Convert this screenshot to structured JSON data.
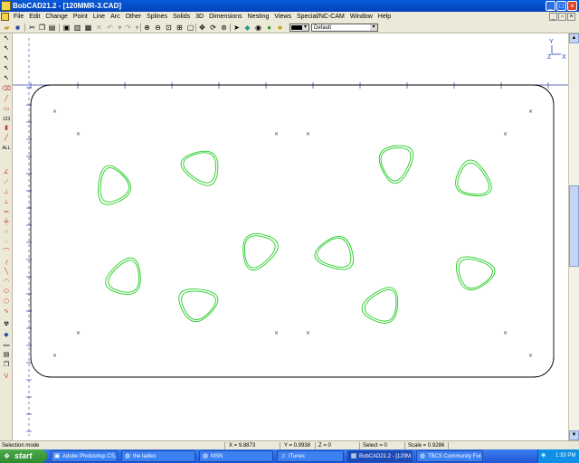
{
  "window": {
    "title": "BobCAD21.2 - [120MMR-3.CAD]"
  },
  "menu": [
    "File",
    "Edit",
    "Change",
    "Point",
    "Line",
    "Arc",
    "Other",
    "Splines",
    "Solids",
    "3D",
    "Dimensions",
    "Nesting",
    "Views",
    "Special/NC-CAM",
    "Window",
    "Help"
  ],
  "toolbar": {
    "color_value": "black",
    "layer_value": "Default"
  },
  "icons": {
    "minimize": "minimize-icon",
    "maximize": "maximize-icon",
    "close": "close-icon"
  },
  "canvas": {
    "axis_labels": {
      "y": "Y",
      "x": "X",
      "z": "Z"
    },
    "outline_color": "#000000",
    "toolpath_color": "#22cc22"
  },
  "status": {
    "mode": "Selection mode",
    "x": "X = 9.8873",
    "y": "Y = 0.9938",
    "z": "Z = 0",
    "select": "Select = 0",
    "scale": "Scale = 0.9286"
  },
  "taskbar": {
    "start": "start",
    "tasks": [
      "Adobe Photoshop CS...",
      "the ladies",
      "MSN",
      "iTunes",
      "BobCAD21.2 - [120M...",
      "TBCS Community For..."
    ],
    "clock": "1:33 PM"
  }
}
